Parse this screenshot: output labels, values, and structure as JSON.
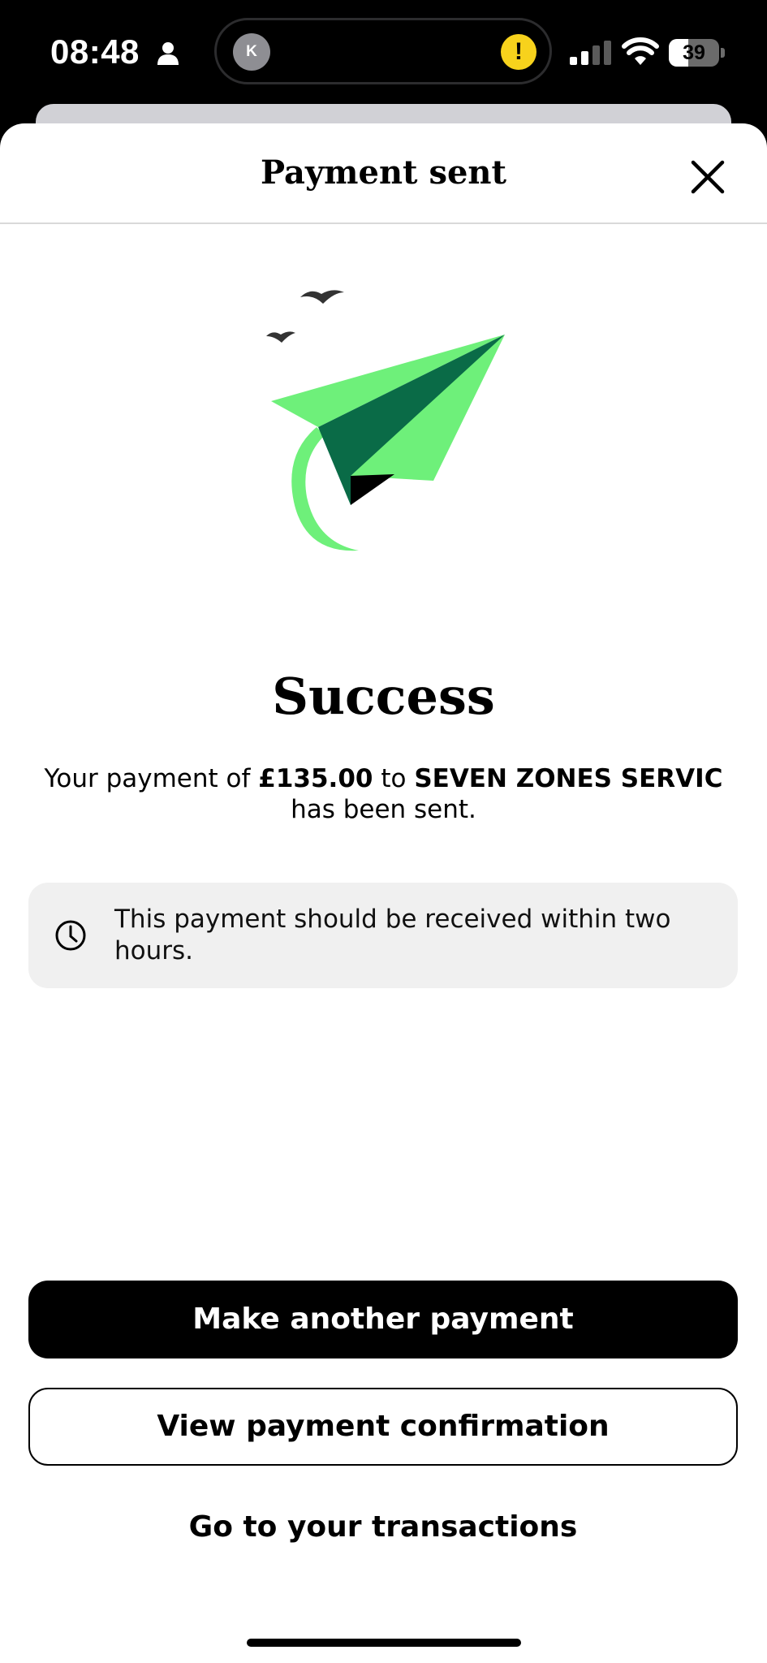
{
  "status_bar": {
    "time": "08:48",
    "island_avatar_initial": "K",
    "island_alert_symbol": "!",
    "battery_level": "39",
    "battery_fraction": 0.39,
    "icons": [
      "person-icon",
      "signal-icon",
      "wifi-icon",
      "battery-icon"
    ]
  },
  "header": {
    "title": "Payment sent",
    "close_icon": "close-icon"
  },
  "illustration": {
    "icon": "paper-plane-icon",
    "colors": {
      "light_green": "#6ef07a",
      "dark_green": "#0a6b47",
      "black": "#000000",
      "bird": "#333333"
    }
  },
  "success": {
    "title": "Success",
    "message_prefix": "Your payment of ",
    "amount": "£135.00",
    "message_middle": " to ",
    "recipient": "SEVEN ZONES SERVIC",
    "message_suffix": " has been sent."
  },
  "info": {
    "icon": "clock-icon",
    "text": "This payment should be received within two hours."
  },
  "actions": {
    "primary_label": "Make another payment",
    "secondary_label": "View payment confirmation",
    "link_label": "Go to your transactions"
  }
}
